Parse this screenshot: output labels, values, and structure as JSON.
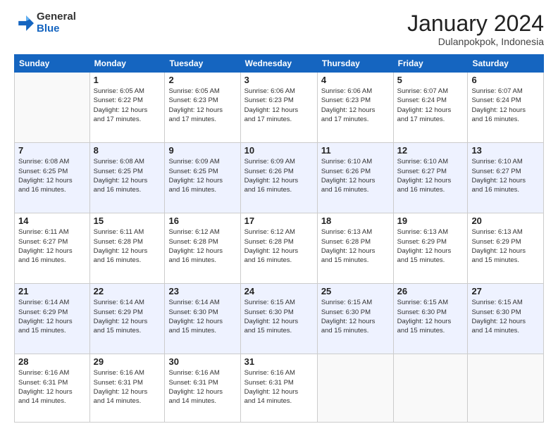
{
  "logo": {
    "general": "General",
    "blue": "Blue"
  },
  "header": {
    "month": "January 2024",
    "location": "Dulanpokpok, Indonesia"
  },
  "weekdays": [
    "Sunday",
    "Monday",
    "Tuesday",
    "Wednesday",
    "Thursday",
    "Friday",
    "Saturday"
  ],
  "weeks": [
    [
      {
        "day": "",
        "info": ""
      },
      {
        "day": "1",
        "info": "Sunrise: 6:05 AM\nSunset: 6:22 PM\nDaylight: 12 hours\nand 17 minutes."
      },
      {
        "day": "2",
        "info": "Sunrise: 6:05 AM\nSunset: 6:23 PM\nDaylight: 12 hours\nand 17 minutes."
      },
      {
        "day": "3",
        "info": "Sunrise: 6:06 AM\nSunset: 6:23 PM\nDaylight: 12 hours\nand 17 minutes."
      },
      {
        "day": "4",
        "info": "Sunrise: 6:06 AM\nSunset: 6:23 PM\nDaylight: 12 hours\nand 17 minutes."
      },
      {
        "day": "5",
        "info": "Sunrise: 6:07 AM\nSunset: 6:24 PM\nDaylight: 12 hours\nand 17 minutes."
      },
      {
        "day": "6",
        "info": "Sunrise: 6:07 AM\nSunset: 6:24 PM\nDaylight: 12 hours\nand 16 minutes."
      }
    ],
    [
      {
        "day": "7",
        "info": "Sunrise: 6:08 AM\nSunset: 6:25 PM\nDaylight: 12 hours\nand 16 minutes."
      },
      {
        "day": "8",
        "info": "Sunrise: 6:08 AM\nSunset: 6:25 PM\nDaylight: 12 hours\nand 16 minutes."
      },
      {
        "day": "9",
        "info": "Sunrise: 6:09 AM\nSunset: 6:25 PM\nDaylight: 12 hours\nand 16 minutes."
      },
      {
        "day": "10",
        "info": "Sunrise: 6:09 AM\nSunset: 6:26 PM\nDaylight: 12 hours\nand 16 minutes."
      },
      {
        "day": "11",
        "info": "Sunrise: 6:10 AM\nSunset: 6:26 PM\nDaylight: 12 hours\nand 16 minutes."
      },
      {
        "day": "12",
        "info": "Sunrise: 6:10 AM\nSunset: 6:27 PM\nDaylight: 12 hours\nand 16 minutes."
      },
      {
        "day": "13",
        "info": "Sunrise: 6:10 AM\nSunset: 6:27 PM\nDaylight: 12 hours\nand 16 minutes."
      }
    ],
    [
      {
        "day": "14",
        "info": "Sunrise: 6:11 AM\nSunset: 6:27 PM\nDaylight: 12 hours\nand 16 minutes."
      },
      {
        "day": "15",
        "info": "Sunrise: 6:11 AM\nSunset: 6:28 PM\nDaylight: 12 hours\nand 16 minutes."
      },
      {
        "day": "16",
        "info": "Sunrise: 6:12 AM\nSunset: 6:28 PM\nDaylight: 12 hours\nand 16 minutes."
      },
      {
        "day": "17",
        "info": "Sunrise: 6:12 AM\nSunset: 6:28 PM\nDaylight: 12 hours\nand 16 minutes."
      },
      {
        "day": "18",
        "info": "Sunrise: 6:13 AM\nSunset: 6:28 PM\nDaylight: 12 hours\nand 15 minutes."
      },
      {
        "day": "19",
        "info": "Sunrise: 6:13 AM\nSunset: 6:29 PM\nDaylight: 12 hours\nand 15 minutes."
      },
      {
        "day": "20",
        "info": "Sunrise: 6:13 AM\nSunset: 6:29 PM\nDaylight: 12 hours\nand 15 minutes."
      }
    ],
    [
      {
        "day": "21",
        "info": "Sunrise: 6:14 AM\nSunset: 6:29 PM\nDaylight: 12 hours\nand 15 minutes."
      },
      {
        "day": "22",
        "info": "Sunrise: 6:14 AM\nSunset: 6:29 PM\nDaylight: 12 hours\nand 15 minutes."
      },
      {
        "day": "23",
        "info": "Sunrise: 6:14 AM\nSunset: 6:30 PM\nDaylight: 12 hours\nand 15 minutes."
      },
      {
        "day": "24",
        "info": "Sunrise: 6:15 AM\nSunset: 6:30 PM\nDaylight: 12 hours\nand 15 minutes."
      },
      {
        "day": "25",
        "info": "Sunrise: 6:15 AM\nSunset: 6:30 PM\nDaylight: 12 hours\nand 15 minutes."
      },
      {
        "day": "26",
        "info": "Sunrise: 6:15 AM\nSunset: 6:30 PM\nDaylight: 12 hours\nand 15 minutes."
      },
      {
        "day": "27",
        "info": "Sunrise: 6:15 AM\nSunset: 6:30 PM\nDaylight: 12 hours\nand 14 minutes."
      }
    ],
    [
      {
        "day": "28",
        "info": "Sunrise: 6:16 AM\nSunset: 6:31 PM\nDaylight: 12 hours\nand 14 minutes."
      },
      {
        "day": "29",
        "info": "Sunrise: 6:16 AM\nSunset: 6:31 PM\nDaylight: 12 hours\nand 14 minutes."
      },
      {
        "day": "30",
        "info": "Sunrise: 6:16 AM\nSunset: 6:31 PM\nDaylight: 12 hours\nand 14 minutes."
      },
      {
        "day": "31",
        "info": "Sunrise: 6:16 AM\nSunset: 6:31 PM\nDaylight: 12 hours\nand 14 minutes."
      },
      {
        "day": "",
        "info": ""
      },
      {
        "day": "",
        "info": ""
      },
      {
        "day": "",
        "info": ""
      }
    ]
  ]
}
